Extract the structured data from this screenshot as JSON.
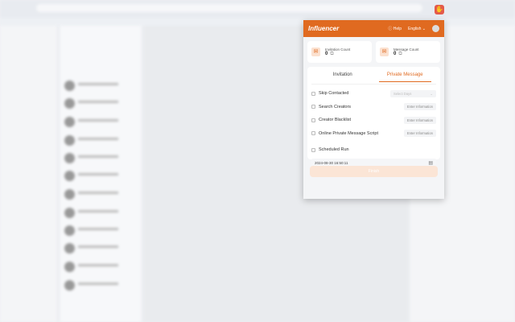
{
  "popup": {
    "brand": "Influencer",
    "help": "Help",
    "language": "English",
    "stats": [
      {
        "label": "Invitation Count",
        "value": "0"
      },
      {
        "label": "Message Count",
        "value": "0"
      }
    ],
    "tabs": [
      "Invitation",
      "Private Message"
    ],
    "options": [
      {
        "label": "Skip Contacted",
        "control": "Select Days"
      },
      {
        "label": "Search Creators",
        "control": "Enter Information"
      },
      {
        "label": "Creator Blacklist",
        "control": "Enter Information"
      },
      {
        "label": "Online Private Message Script",
        "control": "Enter Information"
      }
    ],
    "scheduled": "Scheduled Run",
    "datetime": "2024-08-30 16:50:11",
    "start": "Finish"
  },
  "colors": {
    "accent": "#e06a20"
  }
}
